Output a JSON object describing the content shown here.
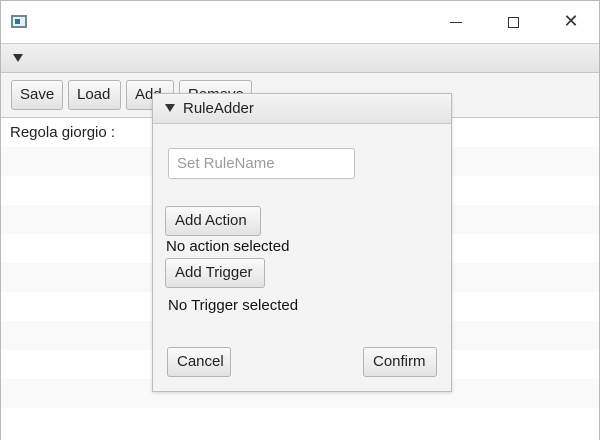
{
  "toolbar": {
    "save_label": "Save",
    "load_label": "Load",
    "add_label": "Add",
    "remove_label": "Remove"
  },
  "rules": [
    {
      "label": "Regola giorgio :"
    },
    {
      "label": ""
    },
    {
      "label": ""
    },
    {
      "label": ""
    },
    {
      "label": ""
    },
    {
      "label": ""
    },
    {
      "label": ""
    },
    {
      "label": ""
    },
    {
      "label": ""
    },
    {
      "label": ""
    },
    {
      "label": ""
    }
  ],
  "dialog": {
    "title": "RuleAdder",
    "rule_name_placeholder": "Set RuleName",
    "rule_name_value": "",
    "add_action_label": "Add Action",
    "action_status": "No action selected",
    "add_trigger_label": "Add Trigger",
    "trigger_status": "No Trigger selected",
    "cancel_label": "Cancel",
    "confirm_label": "Confirm"
  },
  "icons": {
    "window_controls": [
      "minimize-icon",
      "maximize-icon",
      "close-icon"
    ],
    "app": "app-window-icon",
    "menu": "chevron-down-icon"
  }
}
